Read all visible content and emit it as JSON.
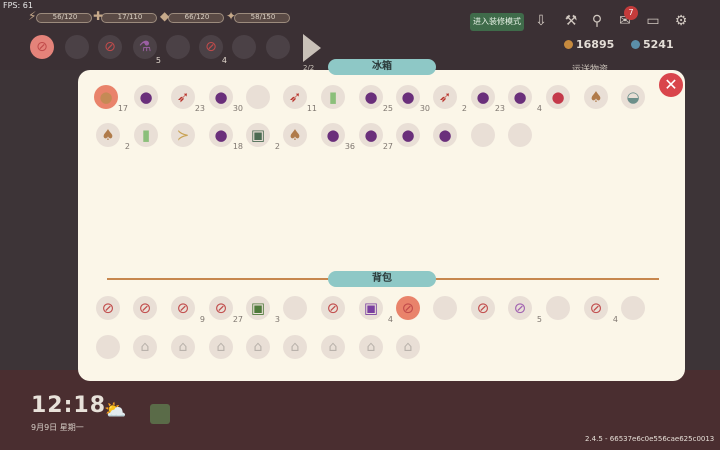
{
  "hud": {
    "fps": "FPS: 61",
    "stats": [
      {
        "icon": "energy-icon",
        "value": "56/120"
      },
      {
        "icon": "health-icon",
        "value": "17/110"
      },
      {
        "icon": "hunger-icon",
        "value": "66/120"
      },
      {
        "icon": "sanity-icon",
        "value": "58/150"
      }
    ],
    "toolbar": [
      {
        "icon": "forbidden-icon",
        "count": ""
      },
      {
        "icon": "empty-slot",
        "count": ""
      },
      {
        "icon": "crossed-tool-icon",
        "count": ""
      },
      {
        "icon": "potion-icon",
        "count": "5"
      },
      {
        "icon": "empty-slot",
        "count": ""
      },
      {
        "icon": "crossed-axe-icon",
        "count": "4"
      },
      {
        "icon": "empty-slot",
        "count": ""
      },
      {
        "icon": "empty-slot",
        "count": ""
      }
    ],
    "toolbar_page": "2/2",
    "build_mode_label": "进入装修模式",
    "mail_badge": "7",
    "coins": "16895",
    "gems": "5241",
    "quest_label": "运送物资"
  },
  "fridge": {
    "title": "冰箱",
    "items": [
      {
        "icon": "potato-icon",
        "qty": "17",
        "selected": true
      },
      {
        "icon": "eggplant-icon",
        "qty": ""
      },
      {
        "icon": "chili-icon",
        "qty": "23"
      },
      {
        "icon": "eggplant-icon",
        "qty": "30"
      },
      {
        "icon": "empty-slot",
        "qty": ""
      },
      {
        "icon": "chili-icon",
        "qty": "11"
      },
      {
        "icon": "juice-icon",
        "qty": ""
      },
      {
        "icon": "eggplant-icon",
        "qty": "25"
      },
      {
        "icon": "eggplant-icon",
        "qty": "30"
      },
      {
        "icon": "chili-icon",
        "qty": "2"
      },
      {
        "icon": "eggplant-icon",
        "qty": "23"
      },
      {
        "icon": "eggplant-icon",
        "qty": "4"
      },
      {
        "icon": "strawberry-icon",
        "qty": ""
      },
      {
        "icon": "mushroom-icon",
        "qty": ""
      },
      {
        "icon": "bowl-icon",
        "qty": ""
      },
      {
        "icon": "mushroom-icon",
        "qty": "2"
      },
      {
        "icon": "juice-icon",
        "qty": ""
      },
      {
        "icon": "fish-icon",
        "qty": ""
      },
      {
        "icon": "eggplant-icon",
        "qty": "18"
      },
      {
        "icon": "card-icon",
        "qty": "2"
      },
      {
        "icon": "mushroom-icon",
        "qty": ""
      },
      {
        "icon": "eggplant-icon",
        "qty": "36"
      },
      {
        "icon": "eggplant-icon",
        "qty": "27"
      },
      {
        "icon": "eggplant-icon",
        "qty": ""
      },
      {
        "icon": "eggplant-icon",
        "qty": ""
      },
      {
        "icon": "empty-slot",
        "qty": ""
      },
      {
        "icon": "empty-slot",
        "qty": ""
      }
    ]
  },
  "backpack": {
    "title": "背包",
    "items": [
      {
        "icon": "crossed-bottle-icon",
        "qty": ""
      },
      {
        "icon": "crossed-phone-icon",
        "qty": ""
      },
      {
        "icon": "crossed-box-icon",
        "qty": "9"
      },
      {
        "icon": "crossed-tool-icon",
        "qty": "27"
      },
      {
        "icon": "seed-bag-icon",
        "qty": "3"
      },
      {
        "icon": "empty-slot",
        "qty": ""
      },
      {
        "icon": "crossed-pick-icon",
        "qty": ""
      },
      {
        "icon": "snack-icon",
        "qty": "4"
      },
      {
        "icon": "hammer-icon",
        "qty": "",
        "selected": true
      },
      {
        "icon": "empty-slot",
        "qty": ""
      },
      {
        "icon": "crossed-axe-icon",
        "qty": ""
      },
      {
        "icon": "crossed-potion-icon",
        "qty": "5"
      },
      {
        "icon": "empty-slot",
        "qty": ""
      },
      {
        "icon": "crossed-berry-icon",
        "qty": "4"
      },
      {
        "icon": "empty-slot",
        "qty": ""
      },
      {
        "icon": "empty-slot",
        "qty": ""
      },
      {
        "icon": "lock-icon",
        "qty": ""
      },
      {
        "icon": "lock-icon",
        "qty": ""
      },
      {
        "icon": "lock-icon",
        "qty": ""
      },
      {
        "icon": "lock-icon",
        "qty": ""
      },
      {
        "icon": "lock-icon",
        "qty": ""
      },
      {
        "icon": "lock-icon",
        "qty": ""
      },
      {
        "icon": "lock-icon",
        "qty": ""
      },
      {
        "icon": "lock-icon",
        "qty": ""
      }
    ]
  },
  "clock": {
    "time": "12:18",
    "date": "9月9日 星期一"
  },
  "version": "2.4.5 - 66537e6c0e556cae625c0013"
}
